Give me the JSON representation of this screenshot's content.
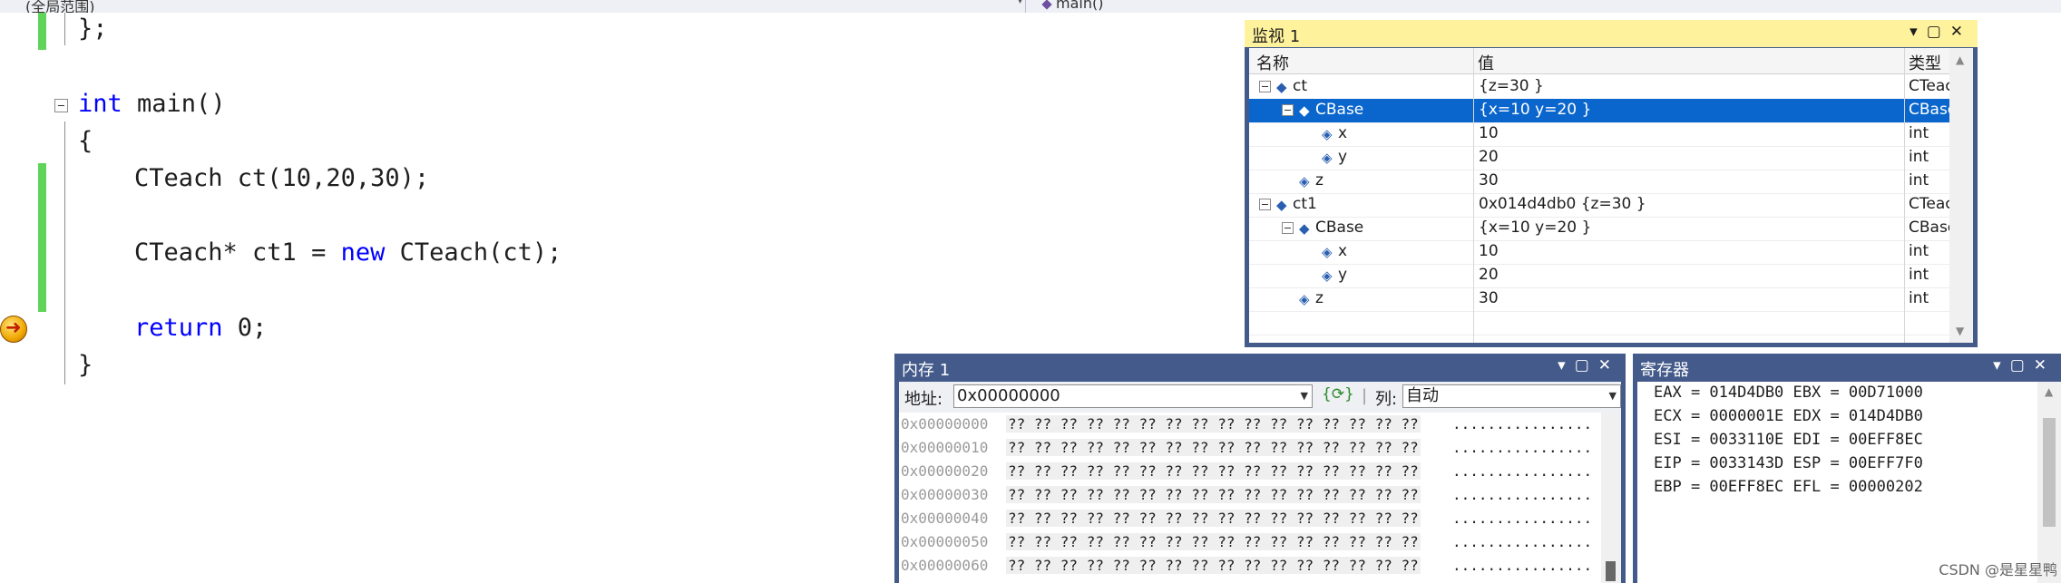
{
  "navbar": {
    "left_label": "(全局范围)",
    "right_label": "main()"
  },
  "editor": {
    "lines": [
      {
        "text": "};"
      },
      {
        "kw": "int",
        "text": " main()"
      },
      {
        "text": "{"
      },
      {
        "text": "CTeach ct(10,20,30);"
      },
      {
        "pre": "CTeach* ct1 = ",
        "kw": "new",
        "post": " CTeach(ct);"
      },
      {
        "kw": "return",
        "text": " 0;"
      },
      {
        "text": "}"
      }
    ]
  },
  "watch": {
    "title": "监视 1",
    "headers": {
      "name": "名称",
      "value": "值",
      "type": "类型"
    },
    "rows": [
      {
        "name": "ct",
        "value": "{z=30 }",
        "type": "CTeach"
      },
      {
        "name": "CBase",
        "value": "{x=10 y=20 }",
        "type": "CBase"
      },
      {
        "name": "x",
        "value": "10",
        "type": "int"
      },
      {
        "name": "y",
        "value": "20",
        "type": "int"
      },
      {
        "name": "z",
        "value": "30",
        "type": "int"
      },
      {
        "name": "ct1",
        "value": "0x014d4db0 {z=30 }",
        "type": "CTeach *"
      },
      {
        "name": "CBase",
        "value": "{x=10 y=20 }",
        "type": "CBase"
      },
      {
        "name": "x",
        "value": "10",
        "type": "int"
      },
      {
        "name": "y",
        "value": "20",
        "type": "int"
      },
      {
        "name": "z",
        "value": "30",
        "type": "int"
      }
    ]
  },
  "memory": {
    "title": "内存 1",
    "address_label": "地址:",
    "address_value": "0x00000000",
    "columns_label": "列:",
    "columns_value": "自动",
    "rows": [
      {
        "addr": "0x00000000",
        "hex": "?? ?? ?? ?? ?? ?? ?? ?? ?? ?? ?? ?? ?? ?? ?? ??",
        "ascii": "................"
      },
      {
        "addr": "0x00000010",
        "hex": "?? ?? ?? ?? ?? ?? ?? ?? ?? ?? ?? ?? ?? ?? ?? ??",
        "ascii": "................"
      },
      {
        "addr": "0x00000020",
        "hex": "?? ?? ?? ?? ?? ?? ?? ?? ?? ?? ?? ?? ?? ?? ?? ??",
        "ascii": "................"
      },
      {
        "addr": "0x00000030",
        "hex": "?? ?? ?? ?? ?? ?? ?? ?? ?? ?? ?? ?? ?? ?? ?? ??",
        "ascii": "................"
      },
      {
        "addr": "0x00000040",
        "hex": "?? ?? ?? ?? ?? ?? ?? ?? ?? ?? ?? ?? ?? ?? ?? ??",
        "ascii": "................"
      },
      {
        "addr": "0x00000050",
        "hex": "?? ?? ?? ?? ?? ?? ?? ?? ?? ?? ?? ?? ?? ?? ?? ??",
        "ascii": "................"
      },
      {
        "addr": "0x00000060",
        "hex": "?? ?? ?? ?? ?? ?? ?? ?? ?? ?? ?? ?? ?? ?? ?? ??",
        "ascii": "................"
      }
    ]
  },
  "registers": {
    "title": "寄存器",
    "lines": [
      "EAX = 014D4DB0 EBX = 00D71000",
      "ECX = 0000001E EDX = 014D4DB0",
      "ESI = 0033110E EDI = 00EFF8EC",
      "EIP = 0033143D ESP = 00EFF7F0",
      "EBP = 00EFF8EC EFL = 00000202"
    ]
  },
  "watermark": "CSDN @是星星鸭",
  "colors": {
    "dock_title": "#435a8a",
    "active_title": "#fff29d",
    "selection": "#0a66cc",
    "keyword": "#0000ff",
    "changed_gutter": "#5fd35a"
  }
}
